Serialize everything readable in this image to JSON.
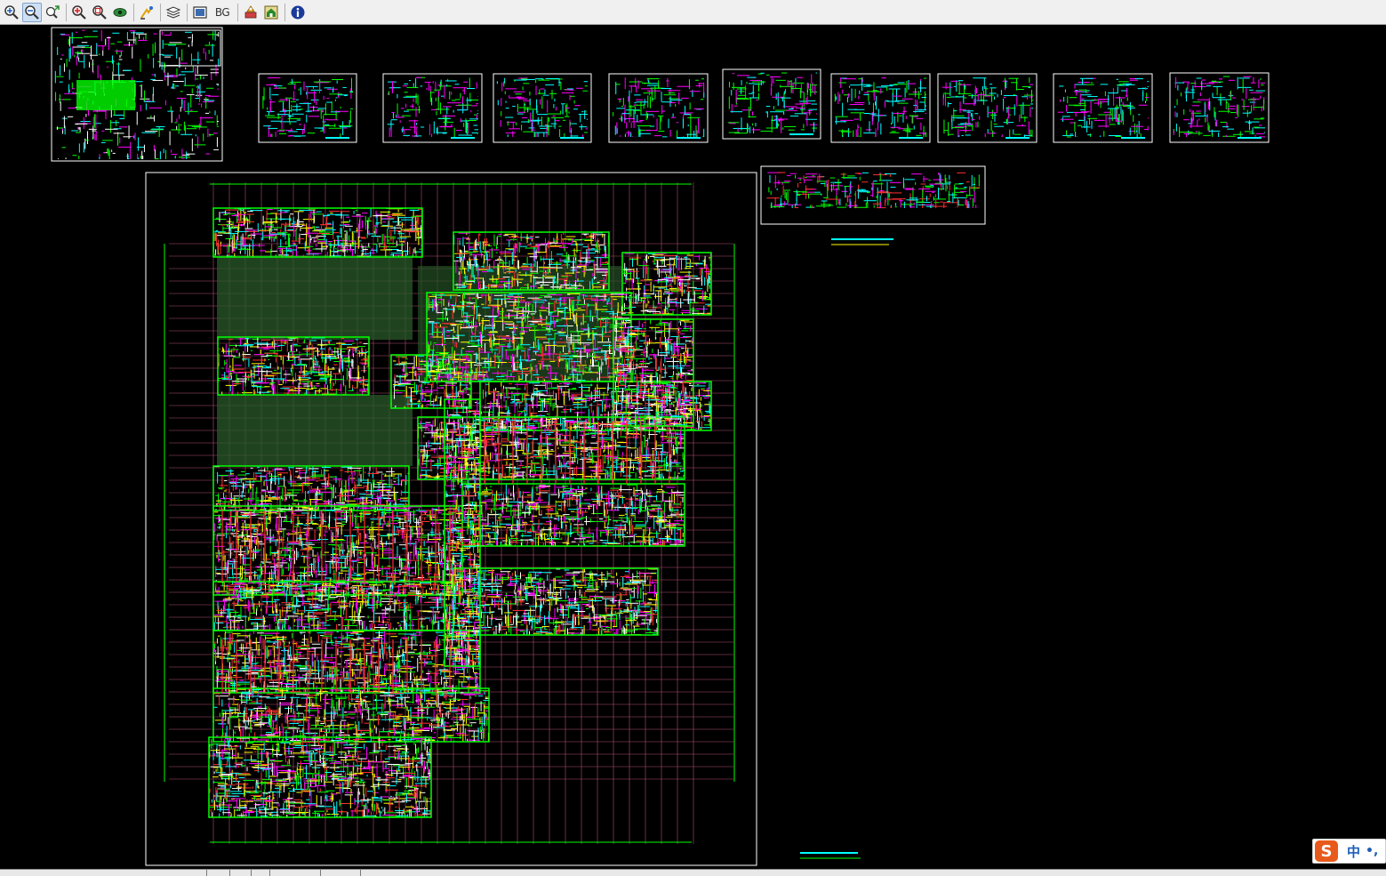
{
  "toolbar": {
    "buttons": [
      {
        "icon": "zoom-in-icon"
      },
      {
        "icon": "zoom-out-icon",
        "active": true
      },
      {
        "icon": "pan-icon"
      },
      {
        "icon": "zoom-window-icon"
      },
      {
        "icon": "zoom-extents-icon"
      },
      {
        "icon": "eye-view-icon"
      },
      {
        "icon": "redraw-icon"
      },
      {
        "icon": "layers-icon"
      },
      {
        "icon": "display-mode-icon"
      },
      {
        "icon": "print-icon"
      },
      {
        "icon": "home-icon"
      },
      {
        "icon": "info-icon"
      }
    ],
    "bg_label": "BG"
  },
  "ime": {
    "logo": "S",
    "mode": "中",
    "punct": "•,"
  },
  "colors": {
    "toolbar_bg": "#f0f0f0",
    "canvas_bg": "#000000",
    "cad_green": "#00ff00",
    "cad_magenta": "#ff00ff",
    "cad_cyan": "#00ffff",
    "cad_yellow": "#ffff00",
    "cad_red": "#ff3030",
    "cad_white": "#ffffff"
  }
}
